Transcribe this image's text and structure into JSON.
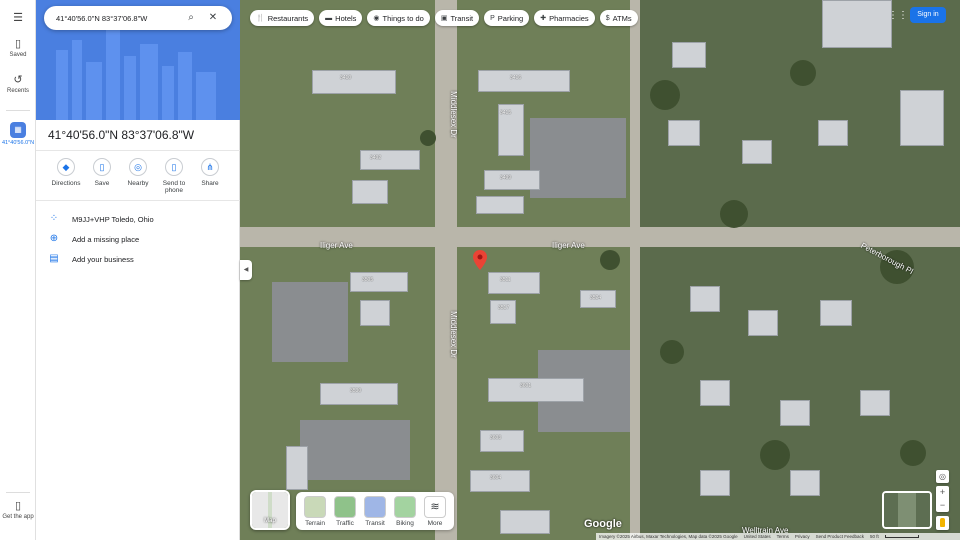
{
  "search": {
    "value": "41°40'56.0\"N 83°37'06.8\"W",
    "search_icon": "search-icon",
    "clear_icon": "close-icon"
  },
  "rail": {
    "menu_icon": "menu-icon",
    "saved_label": "Saved",
    "recents_label": "Recents",
    "current_place_label": "41°40'56.0\"N",
    "get_app_label": "Get the app"
  },
  "chips": [
    {
      "label": "Restaurants",
      "icon": "restaurant-icon"
    },
    {
      "label": "Hotels",
      "icon": "hotel-icon"
    },
    {
      "label": "Things to do",
      "icon": "camera-icon"
    },
    {
      "label": "Transit",
      "icon": "transit-icon"
    },
    {
      "label": "Parking",
      "icon": "parking-icon"
    },
    {
      "label": "Pharmacies",
      "icon": "pharmacy-icon"
    },
    {
      "label": "ATMs",
      "icon": "atm-icon"
    }
  ],
  "header": {
    "sign_in_label": "Sign in",
    "apps_icon": "apps-grid-icon"
  },
  "place": {
    "title": "41°40'56.0\"N 83°37'06.8\"W",
    "actions": [
      {
        "label": "Directions",
        "icon": "directions-icon"
      },
      {
        "label": "Save",
        "icon": "bookmark-icon"
      },
      {
        "label": "Nearby",
        "icon": "nearby-icon"
      },
      {
        "label": "Send to phone",
        "icon": "phone-icon"
      },
      {
        "label": "Share",
        "icon": "share-icon"
      }
    ],
    "rows": [
      {
        "text": "M9JJ+VHP Toledo, Ohio",
        "icon": "plus-code-icon"
      },
      {
        "text": "Add a missing place",
        "icon": "add-place-icon"
      },
      {
        "text": "Add your business",
        "icon": "business-icon"
      }
    ]
  },
  "map": {
    "road_labels": [
      "Middlesex Dr",
      "Middlesex Dr",
      "Iliger Ave",
      "Iliger Ave",
      "Peterborough Pl",
      "Welltrain Ave"
    ],
    "addresses": [
      "3410",
      "3416",
      "3402",
      "3409",
      "3415",
      "3505",
      "3511",
      "3517",
      "3524",
      "3530",
      "3601",
      "3603",
      "3604"
    ]
  },
  "layers": {
    "main_label": "Map",
    "items": [
      {
        "label": "Terrain",
        "color": "#c9d9b8"
      },
      {
        "label": "Traffic",
        "color": "#8fc28a"
      },
      {
        "label": "Transit",
        "color": "#9fb6e6"
      },
      {
        "label": "Biking",
        "color": "#a3d3a0"
      },
      {
        "label": "More",
        "color": "#ffffff"
      }
    ]
  },
  "logo": "Google",
  "footer": {
    "imagery": "Imagery ©2025 Airbus, Maxar Technologies, Map data ©2025 Google",
    "country": "United States",
    "terms": "Terms",
    "privacy": "Privacy",
    "feedback": "Send Product Feedback",
    "scale": "50 ft"
  },
  "colors": {
    "accent": "#1a73e8",
    "marker": "#ea4335",
    "hero": "#4a7fe0"
  }
}
